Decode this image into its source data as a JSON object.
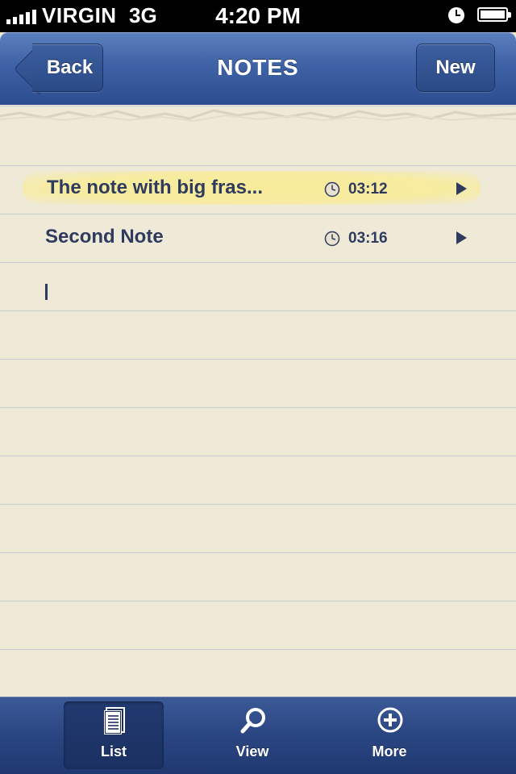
{
  "status_bar": {
    "carrier": "VIRGIN",
    "network": "3G",
    "time": "4:20 PM",
    "icons": [
      "signal-icon",
      "alarm-clock-icon",
      "battery-icon"
    ]
  },
  "nav": {
    "back_label": "Back",
    "title": "NOTES",
    "new_label": "New"
  },
  "notes": [
    {
      "title": "The note with big fras...",
      "time": "03:12",
      "highlighted": true
    },
    {
      "title": "Second Note",
      "time": "03:16",
      "highlighted": false
    }
  ],
  "tabs": [
    {
      "label": "List",
      "icon": "document-list-icon",
      "selected": true
    },
    {
      "label": "View",
      "icon": "search-icon",
      "selected": false
    },
    {
      "label": "More",
      "icon": "plus-circle-icon",
      "selected": false
    }
  ],
  "colors": {
    "nav_blue": "#3f62a6",
    "paper": "#efe9d8",
    "ink": "#2e3a5e",
    "highlight": "#f8ec96"
  }
}
